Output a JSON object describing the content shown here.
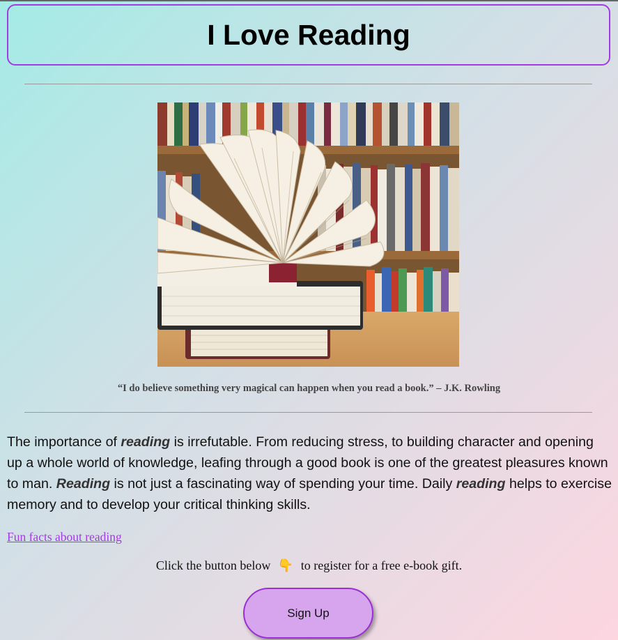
{
  "header": {
    "title": "I Love Reading"
  },
  "image": {
    "alt": "Open book on a stack of books in front of a bookshelf"
  },
  "quote": {
    "text": "“I do believe something very magical can happen when you read a book.” – J.K. Rowling"
  },
  "paragraph": {
    "p1": "The importance of ",
    "em1": "reading",
    "p2": " is irrefutable. From reducing stress, to building character and opening up a whole world of knowledge, leafing through a good book is one of the greatest pleasures known to man. ",
    "em2": "Reading",
    "p3": " is not just a fascinating way of spending your time. Daily ",
    "em3": "reading",
    "p4": " helps to exercise memory and to develop your critical thinking skills."
  },
  "link": {
    "label": "Fun facts about reading"
  },
  "cta": {
    "before": "Click the button below",
    "icon": "pointing-down-hand-icon",
    "icon_glyph": "👇",
    "after": "to register for a free e-book gift."
  },
  "signup": {
    "label": "Sign Up"
  },
  "colors": {
    "accent": "#a23be2",
    "button_fill": "#d7a5ee"
  }
}
